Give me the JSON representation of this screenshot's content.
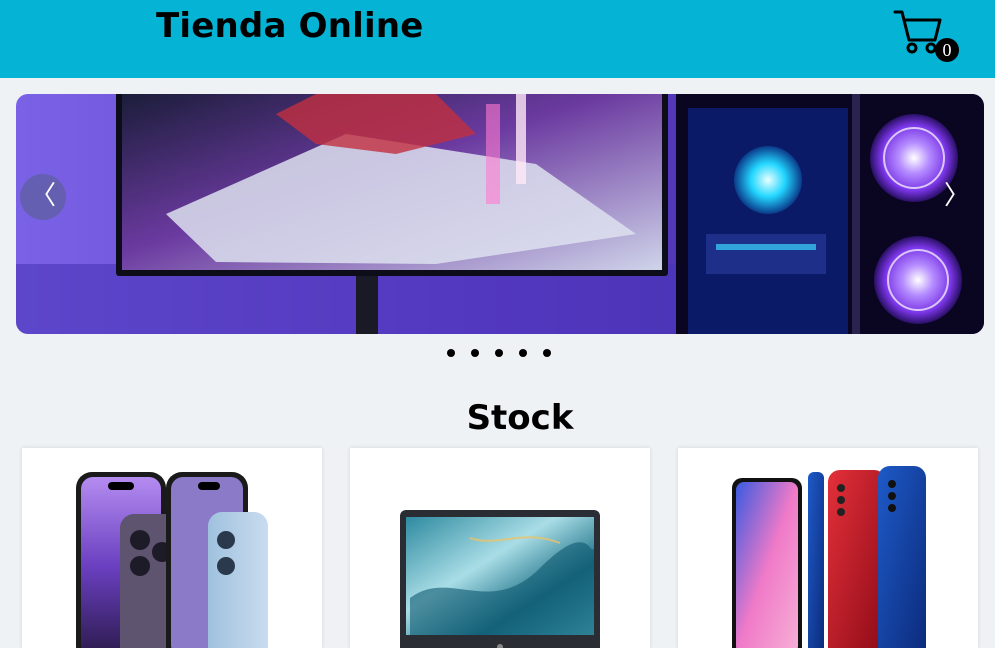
{
  "header": {
    "brand": "Tienda Online",
    "cart_icon": "cart-icon",
    "cart_count": "0",
    "background": "#05b4d4"
  },
  "carousel": {
    "prev_symbol": "〈",
    "next_symbol": "〉",
    "slide_count": 5,
    "active_slide": 1
  },
  "section": {
    "title": "Stock"
  },
  "products": [
    {
      "image": "iphone-image"
    },
    {
      "image": "laptop-image"
    },
    {
      "image": "samsung-phones-image"
    }
  ]
}
